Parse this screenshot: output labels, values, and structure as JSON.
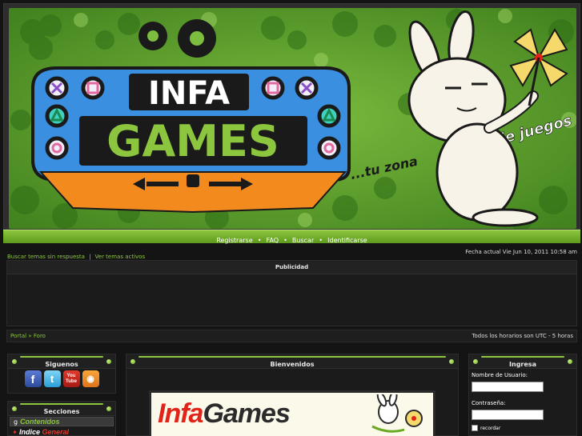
{
  "banner": {
    "logo_infa": "INFA",
    "logo_games": "GAMES",
    "tagline_1": "...tu zona",
    "tagline_2": "de juegos"
  },
  "navbar": {
    "items": [
      "Registrarse",
      "FAQ",
      "Buscar",
      "Identificarse"
    ],
    "separator": "•"
  },
  "info": {
    "link_unanswered": "Buscar temas sin respuesta",
    "pipe": "|",
    "link_active": "Ver temas activos",
    "current_date": "Fecha actual Vie Jun 10, 2011 10:58 am"
  },
  "publicidad": {
    "title": "Publicidad"
  },
  "breadcrumb": {
    "portal": "Portal",
    "arrow": "»",
    "foro": "Foro",
    "timezone": "Todos los horarios son UTC - 5 horas"
  },
  "siguenos": {
    "title": "Siguenos",
    "icons": [
      "facebook-icon",
      "twitter-icon",
      "youtube-icon",
      "rss-icon"
    ],
    "fb_glyph": "f",
    "tw_glyph": "t",
    "yt_glyph_1": "You",
    "yt_glyph_2": "Tube",
    "rss_glyph": "◉"
  },
  "secciones": {
    "title": "Secciones",
    "items": [
      {
        "label": "Contenidos",
        "icon": "g"
      },
      {
        "label_a": "Indice ",
        "label_b": "General",
        "icon": "✦"
      }
    ]
  },
  "bienvenidos": {
    "title": "Bienvenidos",
    "image_text_infa": "Infa",
    "image_text_games": "Games"
  },
  "ingresa": {
    "title": "Ingresa",
    "username_label": "Nombre de Usuario:",
    "password_label": "Contraseña:",
    "remember_label": "recordar"
  },
  "colors": {
    "accent_green": "#8cc63f",
    "background": "#141414",
    "red": "#e2231a"
  }
}
